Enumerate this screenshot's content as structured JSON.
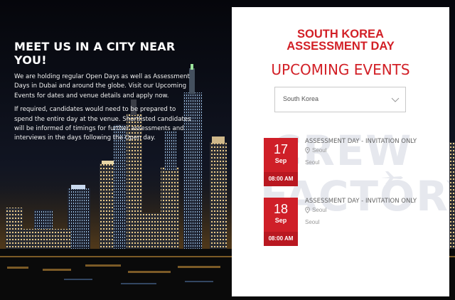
{
  "hero": {
    "heading": "MEET US IN A CITY NEAR YOU!",
    "paragraph1": "We are holding regular Open Days as well as Assessment Days in Dubai and around the globe. Visit our Upcoming Events for dates and venue details and apply now.",
    "paragraph2": "If required, candidates would need to be prepared to spend the entire day at the venue. Shortlisted candidates will be informed of timings for further assessments and interviews in the days following the Open day."
  },
  "panel": {
    "title_line1": "SOUTH KOREA",
    "title_line2": "ASSESSMENT DAY",
    "subtitle": "UPCOMING EVENTS",
    "country_select": {
      "selected": "South Korea",
      "icon": "chevron-down-icon"
    },
    "watermark": {
      "line1": "CREW",
      "line2": "FACTORY",
      "icon": "airplane-icon"
    }
  },
  "events": [
    {
      "day": "17",
      "month": "Sep",
      "time": "08:00 AM",
      "title": "ASSESSMENT DAY - INVITATION ONLY",
      "location": "Seoul",
      "city": "Seoul"
    },
    {
      "day": "18",
      "month": "Sep",
      "time": "08:00 AM",
      "title": "ASSESSMENT DAY - INVITATION ONLY",
      "location": "Seoul",
      "city": "Seoul"
    }
  ],
  "colors": {
    "accent_red": "#d21f26",
    "date_box": "#cf1f28",
    "time_strip": "#b91821",
    "panel_bg": "#ffffff"
  }
}
